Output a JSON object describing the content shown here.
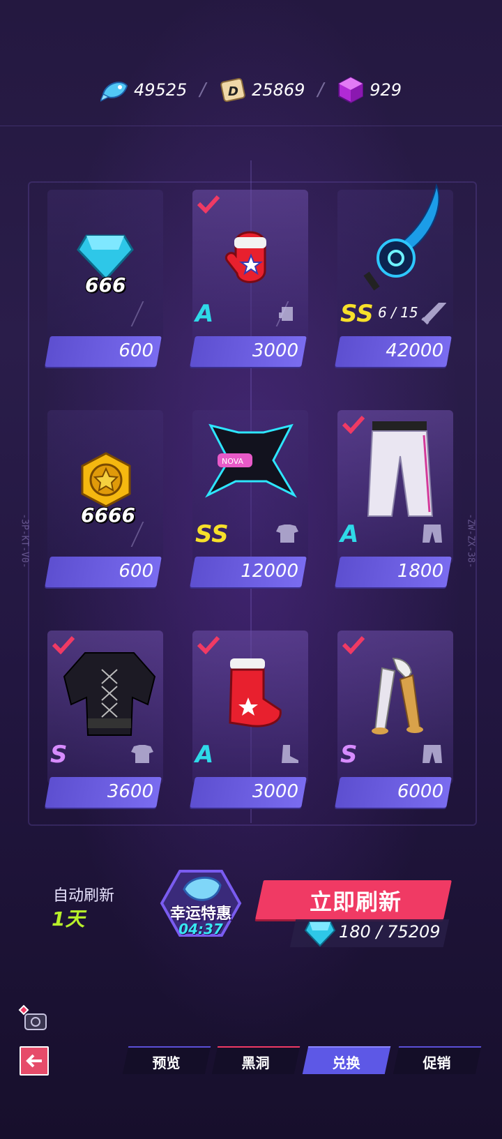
{
  "currencies": {
    "fish": "49525",
    "dcoin": "25869",
    "cube": "929"
  },
  "items": [
    {
      "qty_label": "666",
      "grade": "",
      "count": "",
      "price": "600",
      "owned": false
    },
    {
      "qty_label": "",
      "grade": "A",
      "count": "",
      "price": "3000",
      "owned": true
    },
    {
      "qty_label": "",
      "grade": "SS",
      "count": "6 / 15",
      "price": "42000",
      "owned": false
    },
    {
      "qty_label": "6666",
      "grade": "",
      "count": "",
      "price": "600",
      "owned": false
    },
    {
      "qty_label": "",
      "grade": "SS",
      "count": "",
      "price": "12000",
      "owned": false
    },
    {
      "qty_label": "",
      "grade": "A",
      "count": "",
      "price": "1800",
      "owned": true
    },
    {
      "qty_label": "",
      "grade": "S",
      "count": "",
      "price": "3600",
      "owned": true
    },
    {
      "qty_label": "",
      "grade": "A",
      "count": "",
      "price": "3000",
      "owned": true
    },
    {
      "qty_label": "",
      "grade": "S",
      "count": "",
      "price": "6000",
      "owned": true
    }
  ],
  "side_codes": {
    "left": "-3P-KT-V0-",
    "right": "-ZW-ZX-38-"
  },
  "bottom": {
    "auto_refresh_label": "自动刷新",
    "auto_refresh_days": "1天",
    "lucky_title": "幸运特惠",
    "lucky_timer": "04:37",
    "refresh_label": "立即刷新",
    "refresh_cost": "180 / 75209"
  },
  "tabs": [
    {
      "label": "预览",
      "active": false
    },
    {
      "label": "黑洞",
      "active": false
    },
    {
      "label": "兑换",
      "active": true
    },
    {
      "label": "促销",
      "active": false
    }
  ],
  "colors": {
    "accent_blue": "#5d58e6",
    "accent_red": "#f03a64",
    "grade_A": "#2fd9e8",
    "grade_SS": "#f7e02a",
    "grade_S": "#d78cff"
  }
}
